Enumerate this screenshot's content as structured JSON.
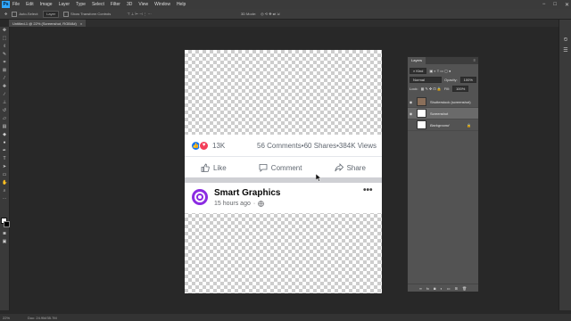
{
  "menubar": {
    "logo": "Ps",
    "items": [
      "File",
      "Edit",
      "Image",
      "Layer",
      "Type",
      "Select",
      "Filter",
      "3D",
      "View",
      "Window",
      "Help"
    ]
  },
  "window_controls": {
    "minimize": "−",
    "maximize": "□",
    "close": "✕"
  },
  "options_bar": {
    "auto_select_label": "Auto-Select:",
    "auto_select_value": "Layer",
    "transform_label": "Show Transform Controls",
    "mode_label": "3D Mode:"
  },
  "document_tab": {
    "title": "Untitled-1 @ 22% (Screenshot, RGB/8#)",
    "close": "×"
  },
  "status_bar": {
    "zoom": "22%",
    "doc_info": "Doc: 24.9M/35.7M"
  },
  "post": {
    "like_count": "13K",
    "comments": "56 Comments",
    "shares": "60 Shares",
    "views": "384K Views",
    "dot": " • ",
    "actions": {
      "like": "Like",
      "comment": "Comment",
      "share": "Share"
    },
    "page_name": "Smart Graphics",
    "time": "15 hours ago",
    "time_sep": "·",
    "more": "•••"
  },
  "layers_panel": {
    "tab": "Layers",
    "menu": "≡",
    "kind_label": "Kind",
    "blend_mode": "Normal",
    "opacity_label": "Opacity:",
    "opacity_value": "100%",
    "lock_label": "Lock:",
    "fill_label": "Fill:",
    "fill_value": "100%",
    "layers": [
      {
        "name": "Shutterstock (screenshot)",
        "visible": true
      },
      {
        "name": "Screenshot",
        "visible": true,
        "selected": true
      },
      {
        "name": "Background",
        "visible": false,
        "locked": true
      }
    ]
  },
  "colors": {
    "fb_like_blue": "#1877f2",
    "fb_love_red": "#f33e58",
    "brand_purple": "#8b2be2",
    "ps_blue": "#31a8ff"
  }
}
